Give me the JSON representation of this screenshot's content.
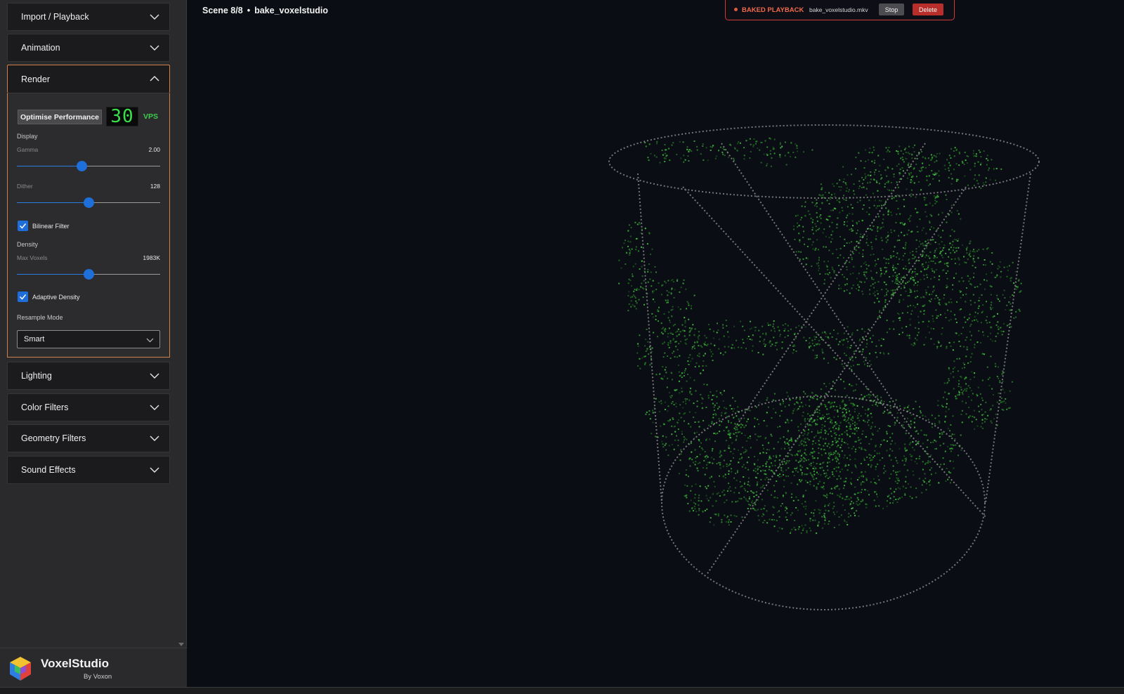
{
  "sidebar": {
    "panels": {
      "import": "Import / Playback",
      "animation": "Animation",
      "render": "Render",
      "lighting": "Lighting",
      "color": "Color Filters",
      "geometry": "Geometry Filters",
      "sound": "Sound Effects"
    },
    "render": {
      "optimise_label": "Optimise Performance",
      "vps_value": "30",
      "vps_label": "VPS",
      "display_section": "Display",
      "gamma_label": "Gamma",
      "gamma_value": "2.00",
      "gamma_fraction": 0.45,
      "dither_label": "Dither",
      "dither_value": "128",
      "dither_fraction": 0.5,
      "bilinear_label": "Bilinear Filter",
      "bilinear_checked": true,
      "density_section": "Density",
      "max_voxels_label": "Max Voxels",
      "max_voxels_value": "1983K",
      "max_voxels_fraction": 0.5,
      "adaptive_label": "Adaptive Density",
      "adaptive_checked": true,
      "resample_label": "Resample Mode",
      "resample_value": "Smart"
    }
  },
  "footer": {
    "app_name": "VoxelStudio",
    "app_sub": "By Voxon"
  },
  "viewport": {
    "scene_index": "Scene 8/8",
    "separator": "•",
    "scene_name": "bake_voxelstudio"
  },
  "playback": {
    "label": "BAKED PLAYBACK",
    "file": "bake_voxelstudio.mkv",
    "stop_label": "Stop",
    "delete_label": "Delete"
  },
  "colors": {
    "accent": "#d2804a",
    "slider_blue": "#1e6fd9",
    "vps_green": "#39e04a",
    "voxel_green": "#2e9a2e",
    "alert_red": "#d23a34"
  },
  "icons": {
    "panel_toggle": "chevron-down-icon",
    "panel_open": "chevron-up-icon",
    "checkbox": "check-icon",
    "logo": "voxelstudio-cube-logo-icon"
  }
}
